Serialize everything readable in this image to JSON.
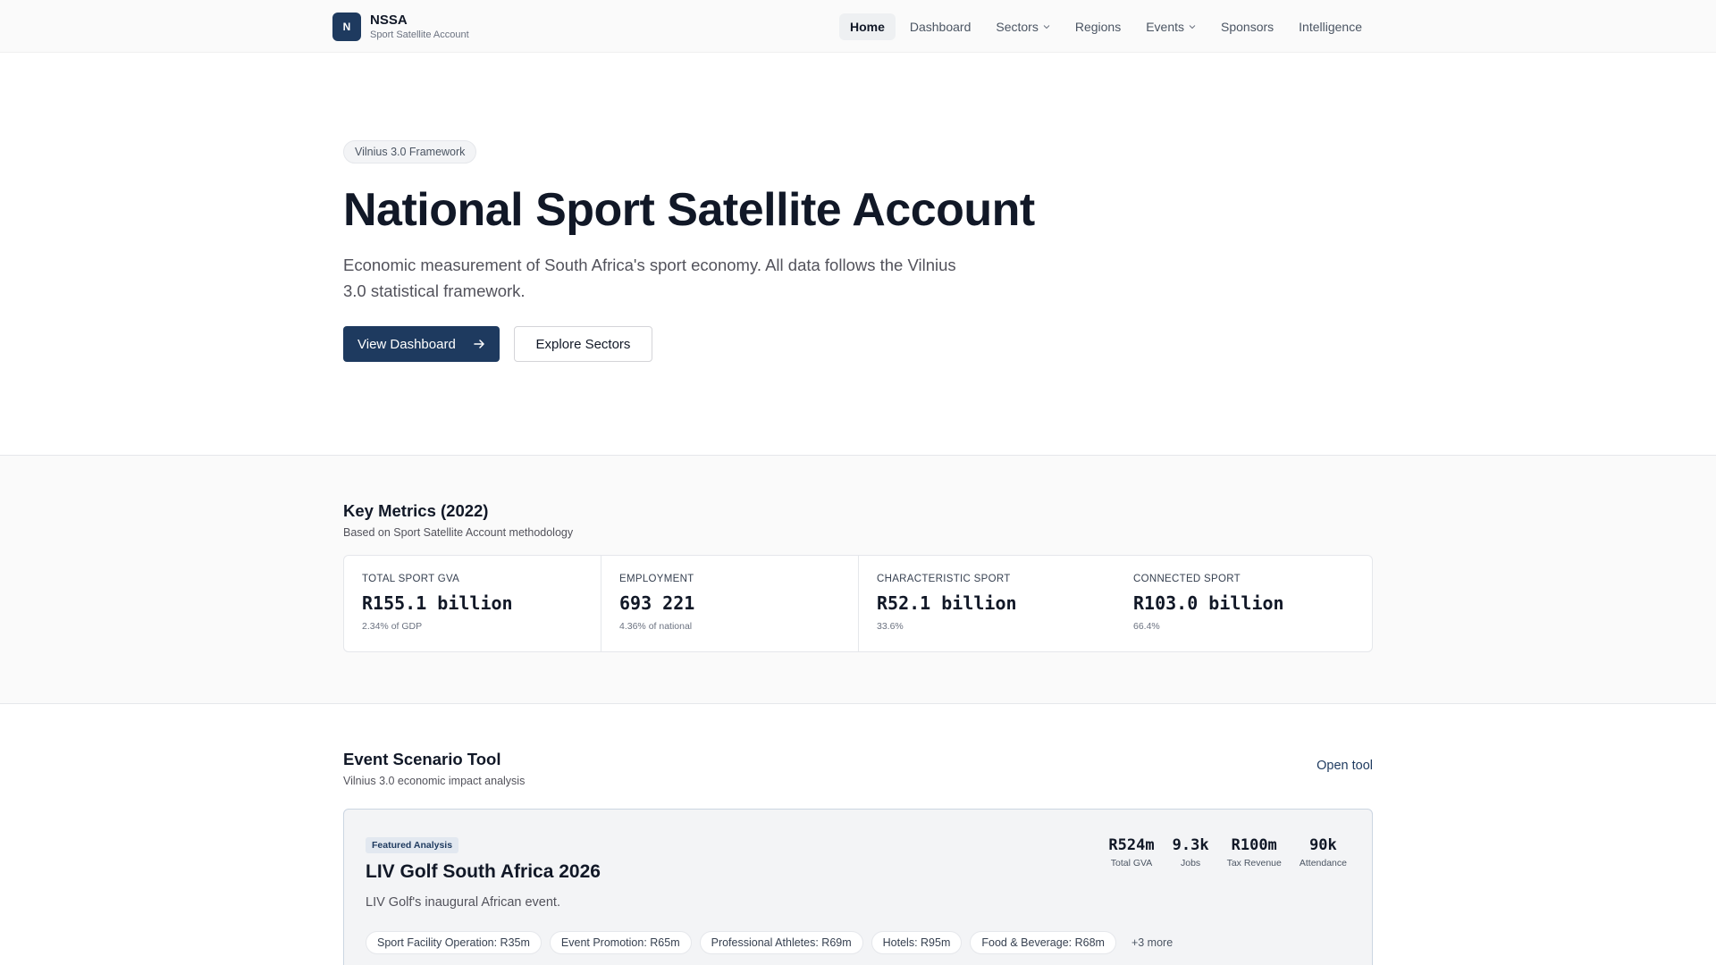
{
  "header": {
    "logo_letter": "N",
    "brand_name": "NSSA",
    "brand_sub": "Sport Satellite Account",
    "nav": [
      {
        "label": "Home"
      },
      {
        "label": "Dashboard"
      },
      {
        "label": "Sectors"
      },
      {
        "label": "Regions"
      },
      {
        "label": "Events"
      },
      {
        "label": "Sponsors"
      },
      {
        "label": "Intelligence"
      }
    ]
  },
  "hero": {
    "pill": "Vilnius 3.0 Framework",
    "title": "National Sport Satellite Account",
    "description": "Economic measurement of South Africa's sport economy. All data follows the Vilnius 3.0 statistical framework.",
    "primary_button": "View Dashboard",
    "secondary_button": "Explore Sectors"
  },
  "metrics": {
    "title": "Key Metrics (2022)",
    "subtitle": "Based on Sport Satellite Account methodology",
    "items": [
      {
        "label": "TOTAL SPORT GVA",
        "value": "R155.1 billion",
        "note": "2.34% of GDP"
      },
      {
        "label": "EMPLOYMENT",
        "value": "693 221",
        "note": "4.36% of national"
      },
      {
        "label": "CHARACTERISTIC SPORT",
        "value": "R52.1 billion",
        "note": "33.6%"
      },
      {
        "label": "CONNECTED SPORT",
        "value": "R103.0 billion",
        "note": "66.4%"
      }
    ]
  },
  "events": {
    "title": "Event Scenario Tool",
    "subtitle": "Vilnius 3.0 economic impact analysis",
    "open_tool": "Open tool",
    "card": {
      "badge": "Featured Analysis",
      "title": "LIV Golf South Africa 2026",
      "description": "LIV Golf's inaugural African event.",
      "stats": [
        {
          "value": "R524m",
          "label": "Total GVA"
        },
        {
          "value": "9.3k",
          "label": "Jobs"
        },
        {
          "value": "R100m",
          "label": "Tax Revenue"
        },
        {
          "value": "90k",
          "label": "Attendance"
        }
      ],
      "tags": [
        "Sport Facility Operation: R35m",
        "Event Promotion: R65m",
        "Professional Athletes: R69m",
        "Hotels: R95m",
        "Food & Beverage: R68m"
      ],
      "more": "+3 more"
    }
  }
}
